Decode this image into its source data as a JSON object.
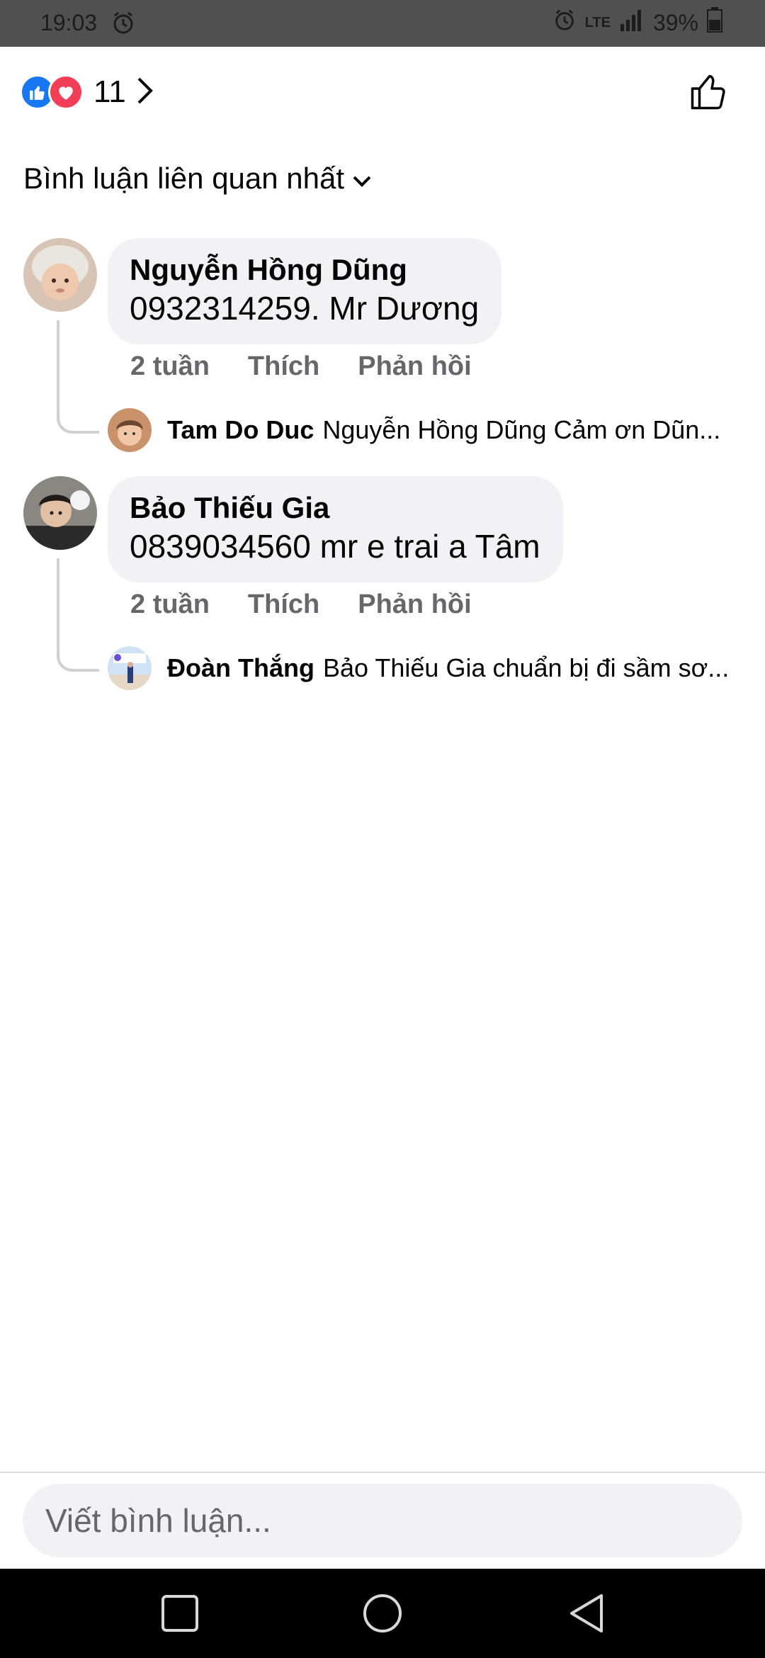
{
  "status_bar": {
    "time": "19:03",
    "network": "LTE",
    "battery": "39%"
  },
  "reactions": {
    "count": "11",
    "icons": [
      "like-icon",
      "love-icon"
    ]
  },
  "sort": {
    "label": "Bình luận liên quan nhất"
  },
  "comments": [
    {
      "author": "Nguyễn Hồng Dũng",
      "text": "0932314259. Mr Dương",
      "time": "2 tuần",
      "like_label": "Thích",
      "reply_label": "Phản hồi",
      "reply": {
        "author": "Tam Do Duc",
        "text": "Nguyễn Hồng Dũng Cảm ơn Dũn..."
      }
    },
    {
      "author": "Bảo Thiếu Gia",
      "text": "0839034560 mr e trai a Tâm",
      "time": "2 tuần",
      "like_label": "Thích",
      "reply_label": "Phản hồi",
      "reply": {
        "author": "Đoàn Thắng",
        "text": "Bảo Thiếu Gia chuẩn bị đi sầm sơ..."
      }
    }
  ],
  "composer": {
    "placeholder": "Viết bình luận..."
  },
  "colors": {
    "like_blue": "#1877f2",
    "love_red": "#f33e58",
    "bubble_bg": "#f0f2f5",
    "meta_gray": "#65676b"
  }
}
